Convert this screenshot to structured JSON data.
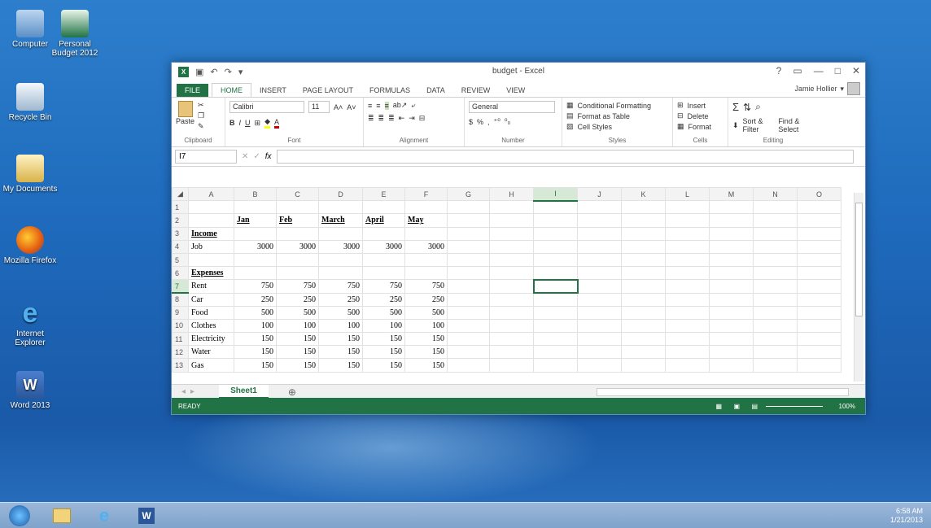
{
  "desktop": {
    "icons": [
      {
        "label": "Computer"
      },
      {
        "label": "Personal Budget 2012"
      },
      {
        "label": "Recycle Bin"
      },
      {
        "label": "My Documents"
      },
      {
        "label": "Mozilla Firefox"
      },
      {
        "label": "Internet Explorer"
      },
      {
        "label": "Word 2013"
      }
    ]
  },
  "window": {
    "title": "budget - Excel",
    "user": "Jamie Hollier",
    "help": "?",
    "tabs": [
      "FILE",
      "HOME",
      "INSERT",
      "PAGE LAYOUT",
      "FORMULAS",
      "DATA",
      "REVIEW",
      "VIEW"
    ],
    "active_tab": "HOME"
  },
  "ribbon": {
    "clipboard": {
      "paste": "Paste",
      "label": "Clipboard"
    },
    "font": {
      "name": "Calibri",
      "size": "11",
      "label": "Font",
      "bold": "B",
      "italic": "I",
      "underline": "U"
    },
    "alignment": {
      "label": "Alignment"
    },
    "number": {
      "format": "General",
      "currency": "$",
      "percent": "%",
      "comma": ",",
      "label": "Number"
    },
    "styles": {
      "conditional": "Conditional Formatting",
      "table": "Format as Table",
      "cell": "Cell Styles",
      "label": "Styles"
    },
    "cells": {
      "insert": "Insert",
      "delete": "Delete",
      "format": "Format",
      "label": "Cells"
    },
    "editing": {
      "sort": "Sort & Filter",
      "find": "Find & Select",
      "label": "Editing",
      "sigma": "Σ"
    }
  },
  "formula_bar": {
    "name_box": "I7",
    "fx": "fx",
    "value": ""
  },
  "sheet": {
    "columns": [
      "A",
      "B",
      "C",
      "D",
      "E",
      "F",
      "G",
      "H",
      "I",
      "J",
      "K",
      "L",
      "M",
      "N",
      "O"
    ],
    "selected_col": "I",
    "selected_row": "7",
    "rows": [
      {
        "n": "1",
        "cells": [
          "",
          "",
          "",
          "",
          "",
          ""
        ]
      },
      {
        "n": "2",
        "cells": [
          "",
          "Jan",
          "Feb",
          "March",
          "April",
          "May"
        ]
      },
      {
        "n": "3",
        "cells": [
          "Income",
          "",
          "",
          "",
          "",
          ""
        ]
      },
      {
        "n": "4",
        "cells": [
          "Job",
          "3000",
          "3000",
          "3000",
          "3000",
          "3000"
        ]
      },
      {
        "n": "5",
        "cells": [
          "",
          "",
          "",
          "",
          "",
          ""
        ]
      },
      {
        "n": "6",
        "cells": [
          "Expenses",
          "",
          "",
          "",
          "",
          ""
        ]
      },
      {
        "n": "7",
        "cells": [
          "Rent",
          "750",
          "750",
          "750",
          "750",
          "750"
        ]
      },
      {
        "n": "8",
        "cells": [
          "Car",
          "250",
          "250",
          "250",
          "250",
          "250"
        ]
      },
      {
        "n": "9",
        "cells": [
          "Food",
          "500",
          "500",
          "500",
          "500",
          "500"
        ]
      },
      {
        "n": "10",
        "cells": [
          "Clothes",
          "100",
          "100",
          "100",
          "100",
          "100"
        ]
      },
      {
        "n": "11",
        "cells": [
          "Electricity",
          "150",
          "150",
          "150",
          "150",
          "150"
        ]
      },
      {
        "n": "12",
        "cells": [
          "Water",
          "150",
          "150",
          "150",
          "150",
          "150"
        ]
      },
      {
        "n": "13",
        "cells": [
          "Gas",
          "150",
          "150",
          "150",
          "150",
          "150"
        ]
      }
    ],
    "sheet_tab": "Sheet1",
    "add_sheet": "⊕"
  },
  "status": {
    "text": "READY",
    "zoom": "100%"
  },
  "taskbar": {
    "time": "6:58 AM",
    "date": "1/21/2013"
  },
  "colors": {
    "excel_green": "#217346"
  }
}
